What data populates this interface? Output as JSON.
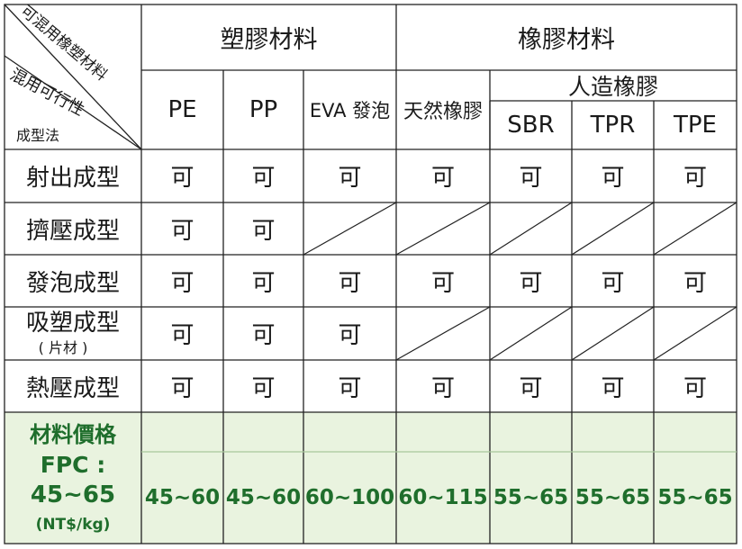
{
  "corner": {
    "top_label": "可混用橡塑材料",
    "mid_label": "混用可行性",
    "bottom_label": "成型法"
  },
  "groups": {
    "plastic": "塑膠材料",
    "rubber": "橡膠材料",
    "synthetic": "人造橡膠"
  },
  "columns": [
    "PE",
    "PP",
    "EVA 發泡",
    "天然橡膠",
    "SBR",
    "TPR",
    "TPE"
  ],
  "rows": [
    {
      "label": "射出成型",
      "sub": "",
      "cells": [
        "可",
        "可",
        "可",
        "可",
        "可",
        "可",
        "可"
      ]
    },
    {
      "label": "擠壓成型",
      "sub": "",
      "cells": [
        "可",
        "可",
        "",
        "",
        "",
        "",
        ""
      ]
    },
    {
      "label": "發泡成型",
      "sub": "",
      "cells": [
        "可",
        "可",
        "可",
        "可",
        "可",
        "可",
        "可"
      ]
    },
    {
      "label": "吸塑成型",
      "sub": "( 片材 )",
      "cells": [
        "可",
        "可",
        "可",
        "",
        "",
        "",
        ""
      ]
    },
    {
      "label": "熱壓成型",
      "sub": "",
      "cells": [
        "可",
        "可",
        "可",
        "可",
        "可",
        "可",
        "可"
      ]
    }
  ],
  "price": {
    "label": "材料價格",
    "fpc_label": "FPC :",
    "fpc_value": "45~65",
    "unit": "(NT$/kg)",
    "values": [
      "45~60",
      "45~60",
      "60~100",
      "60~115",
      "55~65",
      "55~65",
      "55~65"
    ]
  },
  "colors": {
    "line": "#222222",
    "price_band": "#e9f3df",
    "price_text": "#1f6e2c"
  }
}
